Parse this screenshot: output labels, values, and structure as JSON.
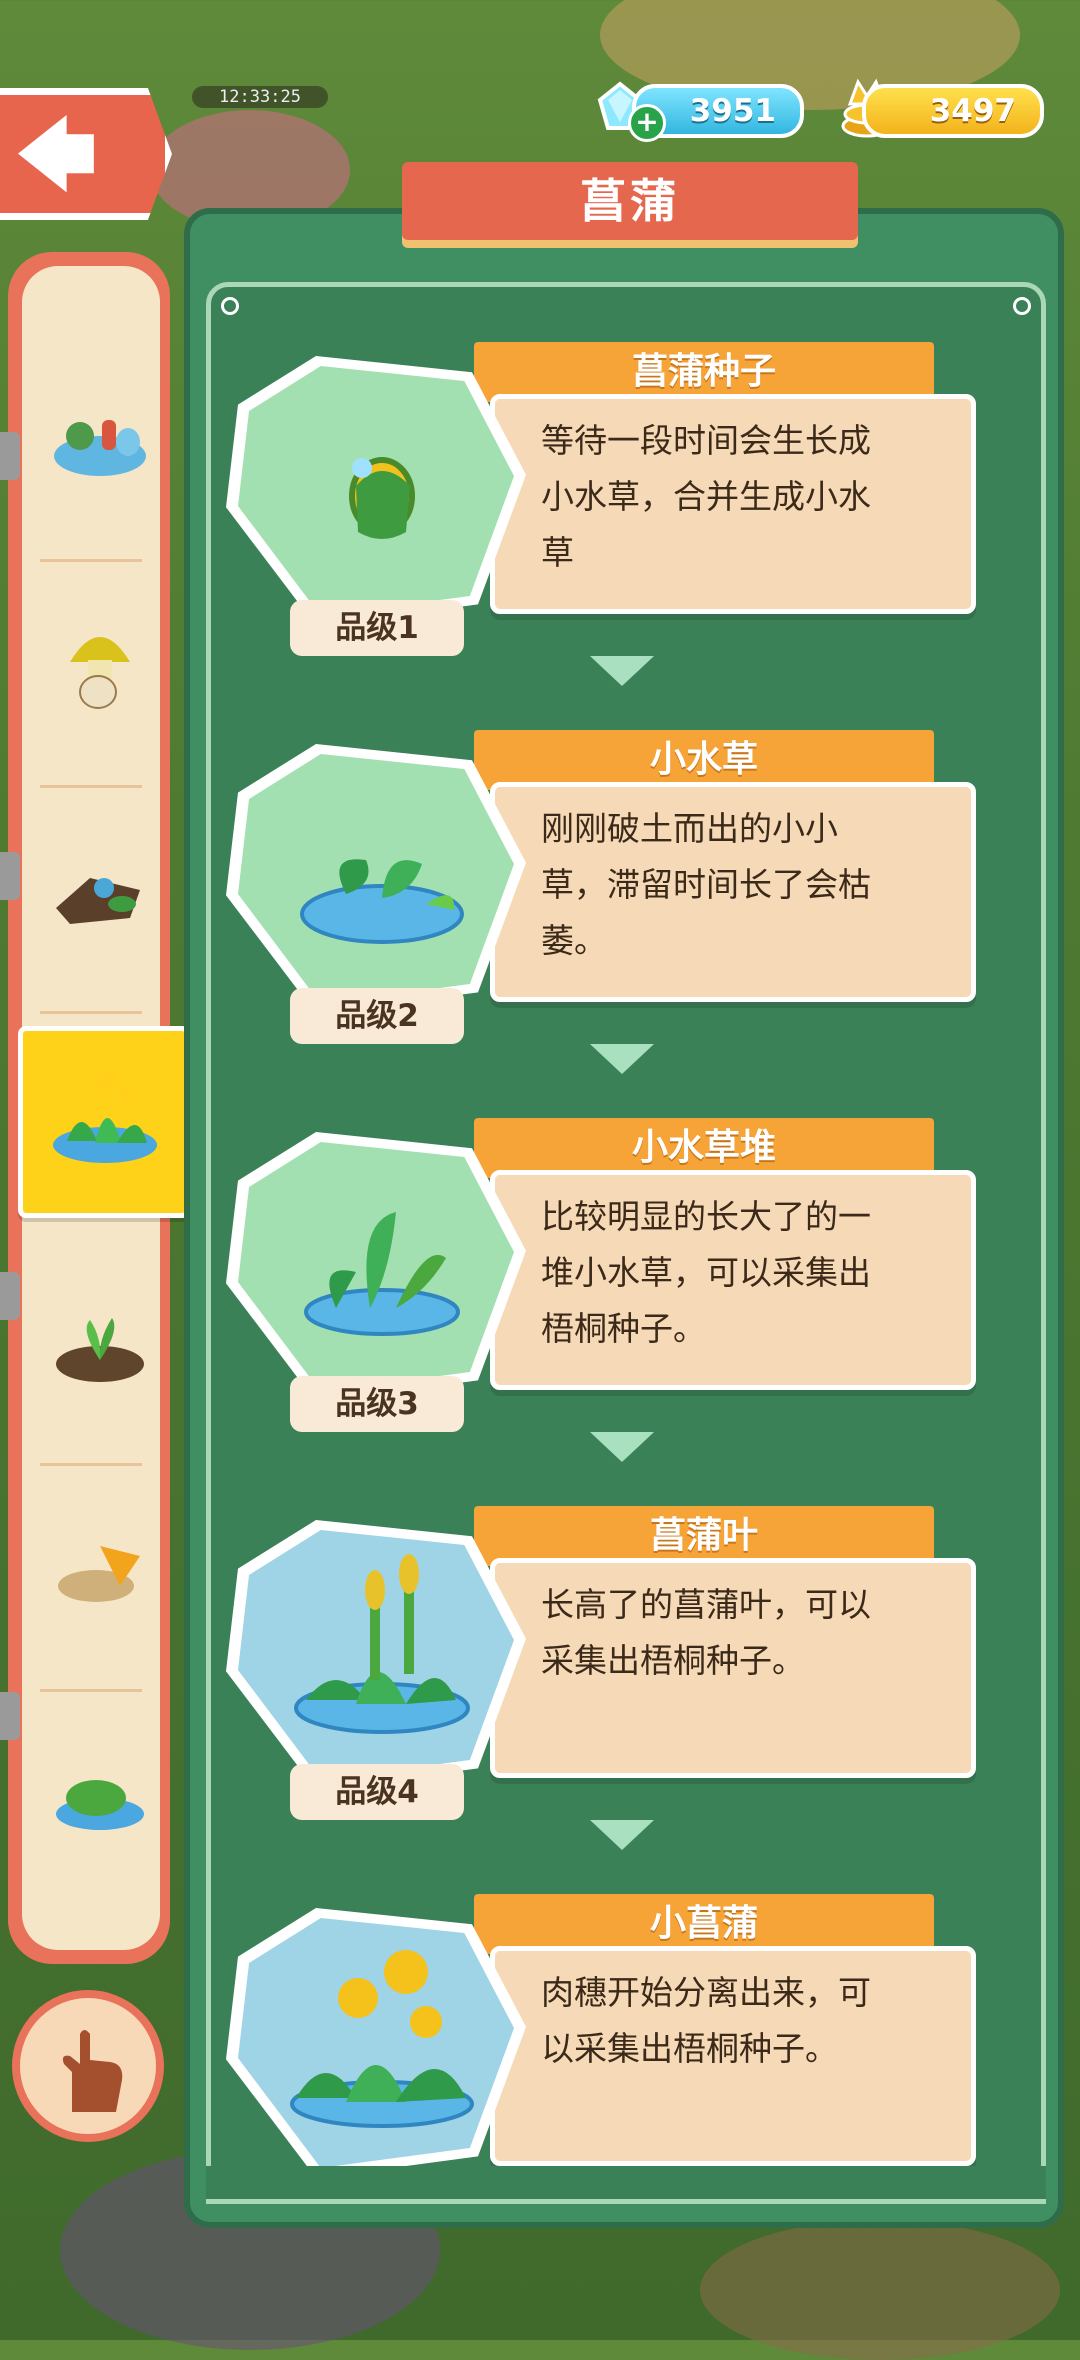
{
  "hud": {
    "time": "12:33:25",
    "gems": "3951",
    "gold": "3497"
  },
  "panel": {
    "title": "菖蒲"
  },
  "sidebar": {
    "tabs": [
      {
        "icon": "pond-creatures-icon",
        "active": false
      },
      {
        "icon": "mushroom-egg-icon",
        "active": false
      },
      {
        "icon": "mossy-log-icon",
        "active": false
      },
      {
        "icon": "yellow-flower-pond-icon",
        "active": true
      },
      {
        "icon": "sprout-soil-icon",
        "active": false
      },
      {
        "icon": "leaf-rock-icon",
        "active": false
      },
      {
        "icon": "moss-puddle-icon",
        "active": false
      }
    ]
  },
  "stages": [
    {
      "name": "菖蒲种子",
      "desc_lines": [
        "等待一段时间会生长成",
        "小水草，合并生成小水",
        "草"
      ],
      "grade": "品级1",
      "icon": "seed-icon"
    },
    {
      "name": "小水草",
      "desc_lines": [
        "刚刚破土而出的小小",
        "草，滞留时间长了会枯",
        "萎。"
      ],
      "grade": "品级2",
      "icon": "small-grass-icon"
    },
    {
      "name": "小水草堆",
      "desc_lines": [
        "比较明显的长大了的一",
        "堆小水草，可以采集出",
        "梧桐种子。"
      ],
      "grade": "品级3",
      "icon": "grass-pile-icon"
    },
    {
      "name": "菖蒲叶",
      "desc_lines": [
        "长高了的菖蒲叶，可以",
        "采集出梧桐种子。"
      ],
      "grade": "品级4",
      "icon": "calamus-leaf-icon"
    },
    {
      "name": "小菖蒲",
      "desc_lines": [
        "肉穗开始分离出来，可",
        "以采集出梧桐种子。"
      ],
      "grade": "",
      "icon": "small-calamus-icon"
    }
  ],
  "colors": {
    "panel_green": "#3f8f63",
    "banner_red": "#e4674e",
    "stage_orange": "#f6a338",
    "desc_bg": "#f6d9b6",
    "active_tab": "#ffd21a"
  }
}
